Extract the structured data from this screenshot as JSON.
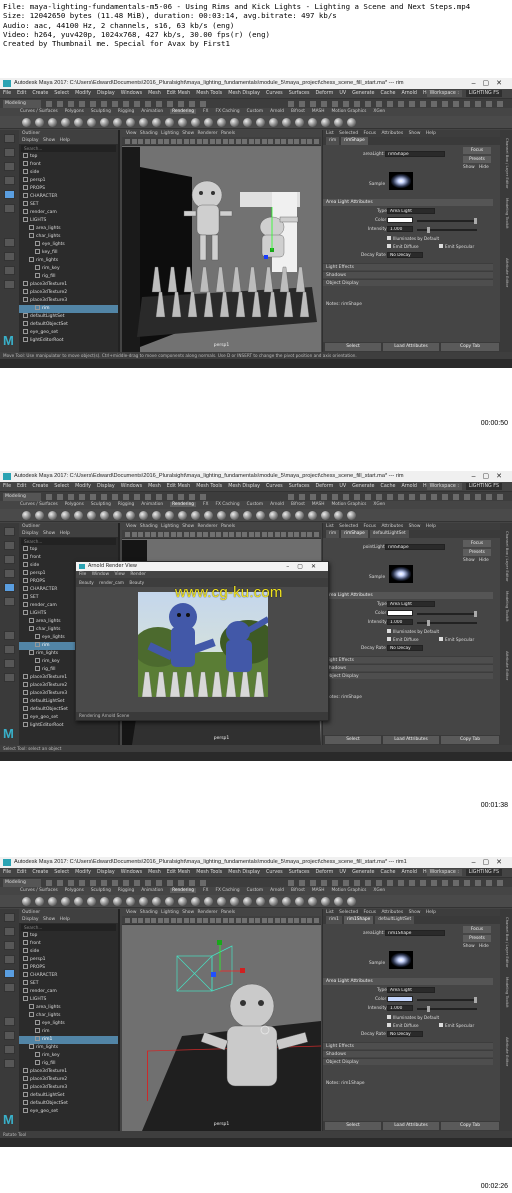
{
  "file_info": [
    "File: maya-lighting-fundamentals-m5-06 - Using Rims and Kick Lights - Lighting a Scene and Next Steps.mp4",
    "Size: 12042650 bytes (11.48 MiB), duration: 00:03:14, avg.bitrate: 497 kb/s",
    "Audio: aac, 44100 Hz, 2 channels, s16, 63 kb/s (eng)",
    "Video: h264, yuv420p, 1024x768, 427 kb/s, 30.00 fps(r) (eng)",
    "Created by Thumbnail me. Special for Avax by First1"
  ],
  "maya": {
    "menus": [
      "File",
      "Edit",
      "Create",
      "Select",
      "Modify",
      "Display",
      "Windows",
      "Mesh",
      "Edit Mesh",
      "Mesh Tools",
      "Mesh Display",
      "Curves",
      "Surfaces",
      "Deform",
      "UV",
      "Generate",
      "Cache",
      "Arnold",
      "Help"
    ],
    "workspace_label": "Workspace :",
    "workspace_value": "LIGHTING FS",
    "mode": "Modeling",
    "shelf_tabs": [
      "Curves / Surfaces",
      "Polygons",
      "Sculpting",
      "Rigging",
      "Animation",
      "Rendering",
      "FX",
      "FX Caching",
      "Custom",
      "Arnold",
      "Bifrost",
      "MASH",
      "Motion Graphics",
      "XGen"
    ],
    "active_shelf": "Rendering",
    "outliner_title": "Outliner",
    "outliner_menu": [
      "Display",
      "Show",
      "Help"
    ],
    "outliner_search": "Search...",
    "viewport_menu": [
      "View",
      "Shading",
      "Lighting",
      "Show",
      "Renderer",
      "Panels"
    ],
    "viewport_camera": "persp1",
    "ae_menu": [
      "List",
      "Selected",
      "Focus",
      "Attributes",
      "Show",
      "Help"
    ],
    "focus_btn": "Focus",
    "presets_btn": "Presets",
    "show_btn": "Show",
    "hide_btn": "Hide",
    "sample_label": "Sample",
    "area_light_attrs": "Area Light Attributes",
    "type_label": "Type",
    "type_value": "Area Light",
    "color_label": "Color",
    "intensity_label": "Intensity",
    "intensity_value": "1.000",
    "illum_default": "Illuminates by Default",
    "emit_diffuse": "Emit Diffuse",
    "emit_specular": "Emit Specular",
    "decay_label": "Decay Rate",
    "decay_value": "No Decay",
    "light_effects": "Light Effects",
    "shadows": "Shadows",
    "object_display": "Object Display",
    "notes_label": "Notes:",
    "select_btn": "Select",
    "load_attr_btn": "Load Attributes",
    "copy_tab_btn": "Copy Tab",
    "side_tabs": [
      "Channel Box / Layer Editor",
      "Modeling Toolkit",
      "Attribute Editor"
    ]
  },
  "frames": [
    {
      "title": "Autodesk Maya 2017: C:\\Users\\Edward\\Documents\\2016_Pluralsight\\maya_lighting_fundamentals\\module_5\\maya_project\\chess_scene_fill_start.ma*  ---  rim",
      "timestamp": "00:00:50",
      "ae_tabs": [
        "rim",
        "rimShape"
      ],
      "ae_node": "areaLight:",
      "ae_node_value": "rimShape",
      "help_line": "Move Tool: Use manipulator to move object(s). Ctrl+middle-drag to move components along normals. Use D or INSERT to change the pivot position and axis orientation.",
      "outliner": [
        "top",
        "front",
        "side",
        "persp1",
        "PROPS",
        "CHARACTER",
        "SET",
        "render_cam",
        "LIGHTS",
        "area_lights",
        "char_lights",
        "eye_lights",
        "key_fill",
        "rim_lights",
        "rim_key",
        "rig_fill",
        "place3dTexture1",
        "place3dTexture2",
        "place3dTexture3",
        "rim",
        "defaultLightSet",
        "defaultObjectSet",
        "eye_geo_set",
        "lightEditorRoot"
      ],
      "selected_row": 19
    },
    {
      "title": "Autodesk Maya 2017: C:\\Users\\Edward\\Documents\\2016_Pluralsight\\maya_lighting_fundamentals\\module_5\\maya_project\\chess_scene_fill_start.ma*  ---  rim",
      "timestamp": "00:01:38",
      "ae_tabs": [
        "rim",
        "rimShape",
        "defaultLightSet"
      ],
      "ae_node": "pointLight:",
      "ae_node_value": "rimShape",
      "help_line": "Select Tool: select an object",
      "outliner": [
        "top",
        "front",
        "side",
        "persp1",
        "PROPS",
        "CHARACTER",
        "SET",
        "render_cam",
        "LIGHTS",
        "area_lights",
        "char_lights",
        "eye_lights",
        "rim",
        "rim_lights",
        "rim_key",
        "rig_fill",
        "place3dTexture1",
        "place3dTexture2",
        "place3dTexture3",
        "defaultLightSet",
        "defaultObjectSet",
        "eye_geo_set",
        "lightEditorRoot"
      ],
      "selected_row": 12,
      "render_view": {
        "title": "Arnold Render View",
        "menu": [
          "File",
          "Window",
          "View",
          "Render"
        ],
        "toolbar": [
          "Beauty",
          "render_cam",
          "Beauty"
        ],
        "status": "Rendering Arnold Scene"
      },
      "watermark": "www.cg-ku.com"
    },
    {
      "title": "Autodesk Maya 2017: C:\\Users\\Edward\\Documents\\2016_Pluralsight\\maya_lighting_fundamentals\\module_5\\maya_project\\chess_scene_fill_start.ma*  ---  rim1",
      "timestamp": "00:02:26",
      "ae_tabs": [
        "rim1",
        "rim1Shape",
        "defaultLightSet"
      ],
      "ae_node": "areaLight:",
      "ae_node_value": "rim1Shape",
      "help_line": "Rotate Tool",
      "outliner": [
        "top",
        "front",
        "side",
        "persp1",
        "PROPS",
        "CHARACTER",
        "SET",
        "render_cam",
        "LIGHTS",
        "area_lights",
        "char_lights",
        "eye_lights",
        "rim",
        "rim1",
        "rim_lights",
        "rim_key",
        "rig_fill",
        "place3dTexture1",
        "place3dTexture2",
        "place3dTexture3",
        "defaultLightSet",
        "defaultObjectSet",
        "eye_geo_set"
      ],
      "selected_row": 13
    }
  ]
}
